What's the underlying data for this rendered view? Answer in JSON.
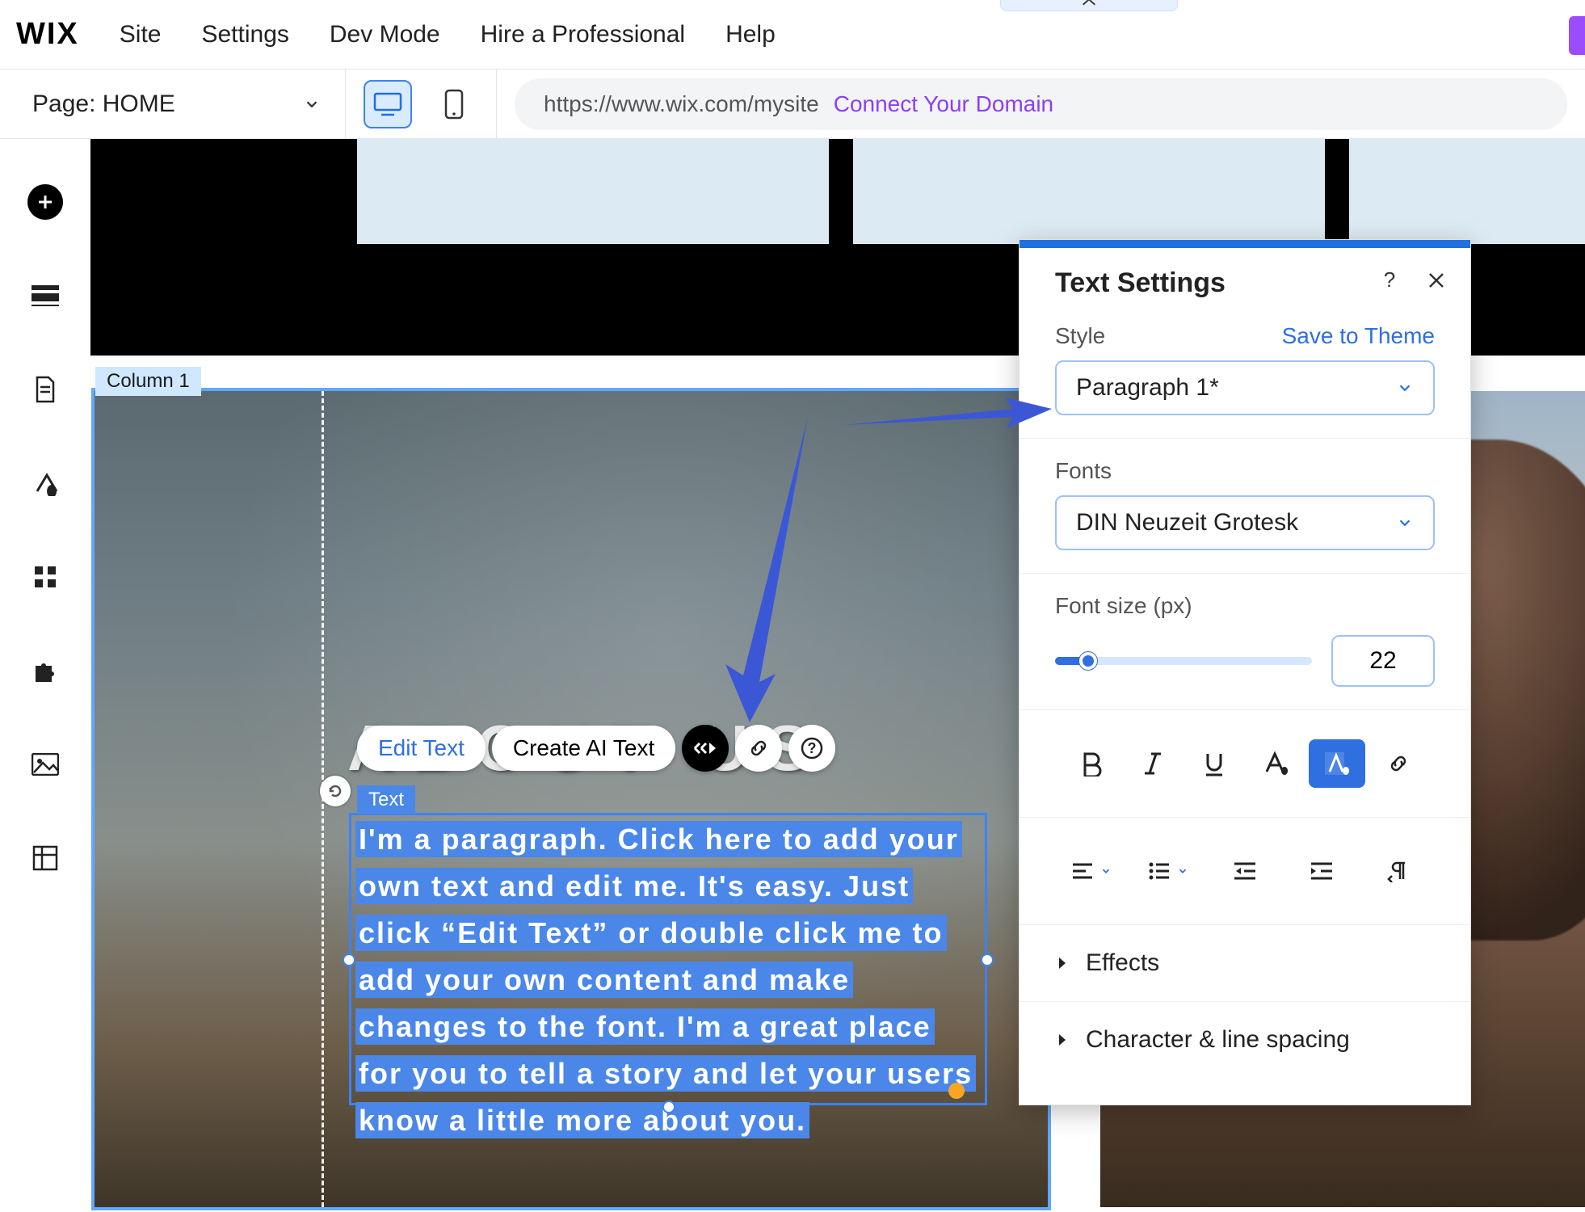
{
  "topbar": {
    "logo": "WIX",
    "menu": [
      "Site",
      "Settings",
      "Dev Mode",
      "Hire a Professional",
      "Help"
    ]
  },
  "subbar": {
    "page_label": "Page: HOME",
    "url": "https://www.wix.com/mysite",
    "connect": "Connect Your Domain"
  },
  "canvas": {
    "column_label": "Column 1",
    "heading": "ABOUT US",
    "edit_text": "Edit Text",
    "create_ai": "Create AI Text",
    "text_tag": "Text",
    "paragraph": "I'm a paragraph. Click here to add your own text and edit me. It's easy. Just click “Edit Text” or double click me to add your own content and make changes to the font. I'm a great place for you to tell a story and let your users know a little more about you."
  },
  "panel": {
    "title": "Text Settings",
    "style": {
      "label": "Style",
      "save": "Save to Theme",
      "value": "Paragraph 1*"
    },
    "fonts": {
      "label": "Fonts",
      "value": "DIN Neuzeit Grotesk"
    },
    "fontsize": {
      "label": "Font size (px)",
      "value": "22"
    },
    "effects": "Effects",
    "spacing": "Character & line spacing"
  }
}
